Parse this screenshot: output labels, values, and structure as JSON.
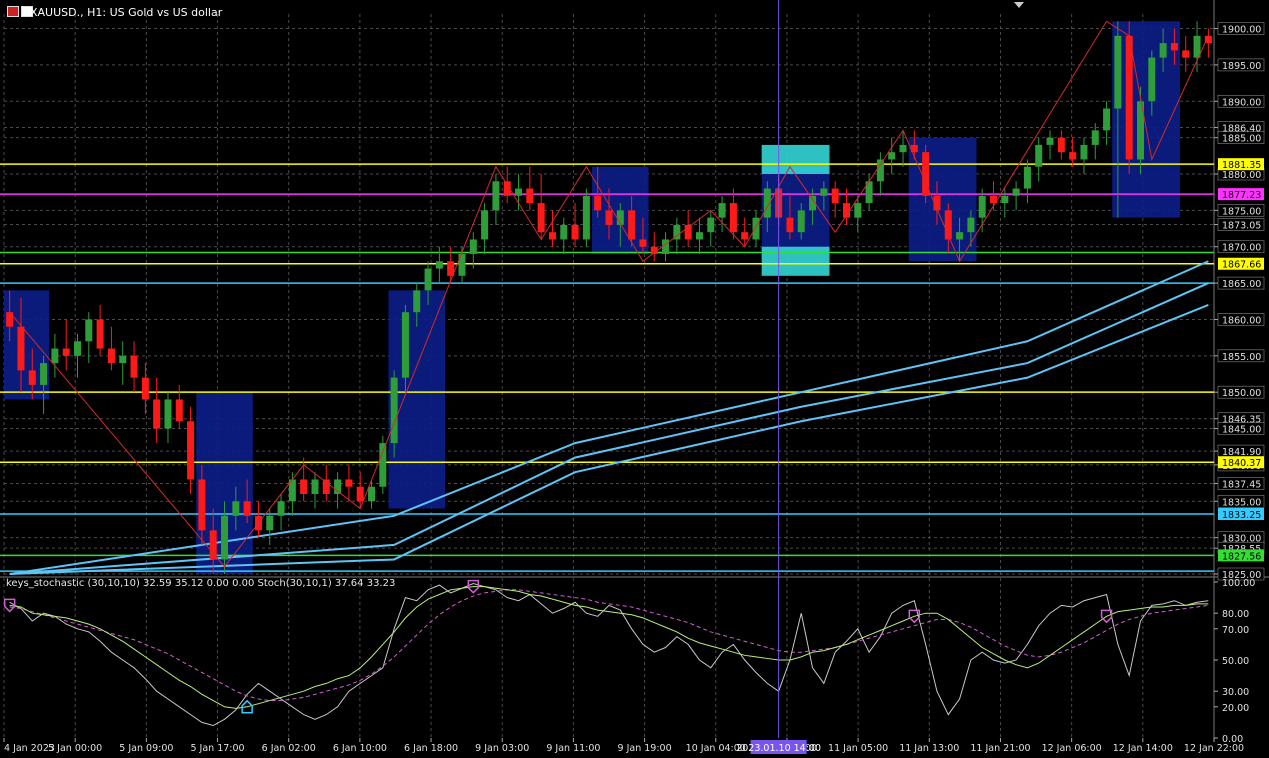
{
  "symbol_title": "XAUUSD., H1:  US Gold vs US dollar",
  "indicator_title": "keys_stochastic (30,10,10) 32.59 35.12 0.00 0.00 Stoch(30,10,1) 37.64 33.23",
  "crosshair_time": "2023.01.10 14:00",
  "icons": [
    "chart-bars-icon",
    "chart-candles-icon"
  ],
  "colors": {
    "bull": "#2e9d3a",
    "bear": "#ff1a1a",
    "zone": "#0b1e8a",
    "zigzag": "#d42a2a",
    "ma": "#5ec4f5",
    "grid": "#4a4a4a",
    "k_line": "#c8c8c8",
    "d_line": "#b7f07a",
    "signal": "#d060d0"
  },
  "chart_data": {
    "type": "candlestick",
    "timeframe": "H1",
    "ylim": [
      1825,
      1902
    ],
    "price_ticks": [
      "1900.00",
      "1895.00",
      "1890.00",
      "1886.40",
      "1885.00",
      "1880.00",
      "1875.00",
      "1873.05",
      "1870.00",
      "1865.00",
      "1860.00",
      "1855.00",
      "1850.00",
      "1846.35",
      "1845.00",
      "1841.90",
      "1840.00",
      "1837.45",
      "1835.00",
      "1830.00",
      "1828.55",
      "1825.00"
    ],
    "time_labels": [
      "4 Jan 2023",
      "5 Jan 00:00",
      "5 Jan 09:00",
      "5 Jan 17:00",
      "6 Jan 02:00",
      "6 Jan 10:00",
      "6 Jan 18:00",
      "9 Jan 03:00",
      "9 Jan 11:00",
      "9 Jan 19:00",
      "10 Jan 04:00",
      "10 Jan 20:00",
      "11 Jan 05:00",
      "11 Jan 13:00",
      "11 Jan 21:00",
      "12 Jan 06:00",
      "12 Jan 14:00",
      "12 Jan 22:00"
    ],
    "horizontal_levels": [
      {
        "price": 1881.35,
        "label": "1881.35",
        "color": "#ffff00"
      },
      {
        "price": 1877.23,
        "label": "1877.23",
        "color": "#ff33ff"
      },
      {
        "price": 1869.2,
        "label": "",
        "color": "#33dd33"
      },
      {
        "price": 1867.66,
        "label": "1867.66",
        "color": "#ffff00"
      },
      {
        "price": 1865.0,
        "label": "",
        "color": "#33ccff"
      },
      {
        "price": 1850.0,
        "label": "",
        "color": "#ffff00"
      },
      {
        "price": 1840.37,
        "label": "1840.37",
        "color": "#ffff00"
      },
      {
        "price": 1833.25,
        "label": "1833.25",
        "color": "#33ccff"
      },
      {
        "price": 1827.56,
        "label": "1827.56",
        "color": "#33dd33"
      },
      {
        "price": 1825.4,
        "label": "",
        "color": "#33ccff"
      }
    ],
    "candles": [
      {
        "o": 1861,
        "h": 1864,
        "l": 1857,
        "c": 1859
      },
      {
        "o": 1859,
        "h": 1863,
        "l": 1850,
        "c": 1853
      },
      {
        "o": 1853,
        "h": 1856,
        "l": 1849,
        "c": 1851
      },
      {
        "o": 1851,
        "h": 1855,
        "l": 1847,
        "c": 1854
      },
      {
        "o": 1854,
        "h": 1858,
        "l": 1852,
        "c": 1856
      },
      {
        "o": 1856,
        "h": 1860,
        "l": 1853,
        "c": 1855
      },
      {
        "o": 1855,
        "h": 1858,
        "l": 1852,
        "c": 1857
      },
      {
        "o": 1857,
        "h": 1861,
        "l": 1854,
        "c": 1860
      },
      {
        "o": 1860,
        "h": 1862,
        "l": 1855,
        "c": 1856
      },
      {
        "o": 1856,
        "h": 1859,
        "l": 1853,
        "c": 1854
      },
      {
        "o": 1854,
        "h": 1857,
        "l": 1851,
        "c": 1855
      },
      {
        "o": 1855,
        "h": 1857,
        "l": 1850,
        "c": 1852
      },
      {
        "o": 1852,
        "h": 1854,
        "l": 1847,
        "c": 1849
      },
      {
        "o": 1849,
        "h": 1852,
        "l": 1843,
        "c": 1845
      },
      {
        "o": 1845,
        "h": 1850,
        "l": 1843,
        "c": 1849
      },
      {
        "o": 1849,
        "h": 1851,
        "l": 1845,
        "c": 1846
      },
      {
        "o": 1846,
        "h": 1848,
        "l": 1836,
        "c": 1838
      },
      {
        "o": 1838,
        "h": 1840,
        "l": 1829,
        "c": 1831
      },
      {
        "o": 1831,
        "h": 1834,
        "l": 1825,
        "c": 1827
      },
      {
        "o": 1827,
        "h": 1835,
        "l": 1825,
        "c": 1833
      },
      {
        "o": 1833,
        "h": 1837,
        "l": 1831,
        "c": 1835
      },
      {
        "o": 1835,
        "h": 1838,
        "l": 1832,
        "c": 1833
      },
      {
        "o": 1833,
        "h": 1835,
        "l": 1830,
        "c": 1831
      },
      {
        "o": 1831,
        "h": 1834,
        "l": 1829,
        "c": 1833
      },
      {
        "o": 1833,
        "h": 1836,
        "l": 1831,
        "c": 1835
      },
      {
        "o": 1835,
        "h": 1839,
        "l": 1833,
        "c": 1838
      },
      {
        "o": 1838,
        "h": 1841,
        "l": 1835,
        "c": 1836
      },
      {
        "o": 1836,
        "h": 1839,
        "l": 1834,
        "c": 1838
      },
      {
        "o": 1838,
        "h": 1840,
        "l": 1835,
        "c": 1836
      },
      {
        "o": 1836,
        "h": 1839,
        "l": 1834,
        "c": 1838
      },
      {
        "o": 1838,
        "h": 1840,
        "l": 1835,
        "c": 1837
      },
      {
        "o": 1837,
        "h": 1839,
        "l": 1834,
        "c": 1835
      },
      {
        "o": 1835,
        "h": 1838,
        "l": 1834,
        "c": 1837
      },
      {
        "o": 1837,
        "h": 1844,
        "l": 1836,
        "c": 1843
      },
      {
        "o": 1843,
        "h": 1853,
        "l": 1841,
        "c": 1852
      },
      {
        "o": 1852,
        "h": 1862,
        "l": 1850,
        "c": 1861
      },
      {
        "o": 1861,
        "h": 1865,
        "l": 1859,
        "c": 1864
      },
      {
        "o": 1864,
        "h": 1868,
        "l": 1862,
        "c": 1867
      },
      {
        "o": 1867,
        "h": 1870,
        "l": 1865,
        "c": 1868
      },
      {
        "o": 1868,
        "h": 1870,
        "l": 1865,
        "c": 1866
      },
      {
        "o": 1866,
        "h": 1870,
        "l": 1865,
        "c": 1869
      },
      {
        "o": 1869,
        "h": 1872,
        "l": 1867,
        "c": 1871
      },
      {
        "o": 1871,
        "h": 1876,
        "l": 1869,
        "c": 1875
      },
      {
        "o": 1875,
        "h": 1880,
        "l": 1873,
        "c": 1879
      },
      {
        "o": 1879,
        "h": 1881,
        "l": 1876,
        "c": 1877
      },
      {
        "o": 1877,
        "h": 1880,
        "l": 1875,
        "c": 1878
      },
      {
        "o": 1878,
        "h": 1881,
        "l": 1875,
        "c": 1876
      },
      {
        "o": 1876,
        "h": 1880,
        "l": 1871,
        "c": 1872
      },
      {
        "o": 1872,
        "h": 1875,
        "l": 1870,
        "c": 1871
      },
      {
        "o": 1871,
        "h": 1874,
        "l": 1869,
        "c": 1873
      },
      {
        "o": 1873,
        "h": 1876,
        "l": 1870,
        "c": 1871
      },
      {
        "o": 1871,
        "h": 1878,
        "l": 1870,
        "c": 1877
      },
      {
        "o": 1877,
        "h": 1881,
        "l": 1874,
        "c": 1875
      },
      {
        "o": 1875,
        "h": 1878,
        "l": 1871,
        "c": 1873
      },
      {
        "o": 1873,
        "h": 1876,
        "l": 1870,
        "c": 1875
      },
      {
        "o": 1875,
        "h": 1877,
        "l": 1870,
        "c": 1871
      },
      {
        "o": 1871,
        "h": 1874,
        "l": 1869,
        "c": 1870
      },
      {
        "o": 1870,
        "h": 1872,
        "l": 1868,
        "c": 1869
      },
      {
        "o": 1869,
        "h": 1872,
        "l": 1868,
        "c": 1871
      },
      {
        "o": 1871,
        "h": 1874,
        "l": 1869,
        "c": 1873
      },
      {
        "o": 1873,
        "h": 1875,
        "l": 1870,
        "c": 1871
      },
      {
        "o": 1871,
        "h": 1874,
        "l": 1869,
        "c": 1872
      },
      {
        "o": 1872,
        "h": 1875,
        "l": 1870,
        "c": 1874
      },
      {
        "o": 1874,
        "h": 1877,
        "l": 1872,
        "c": 1876
      },
      {
        "o": 1876,
        "h": 1878,
        "l": 1871,
        "c": 1872
      },
      {
        "o": 1872,
        "h": 1874,
        "l": 1870,
        "c": 1871
      },
      {
        "o": 1871,
        "h": 1875,
        "l": 1870,
        "c": 1874
      },
      {
        "o": 1874,
        "h": 1879,
        "l": 1872,
        "c": 1878
      },
      {
        "o": 1878,
        "h": 1880,
        "l": 1873,
        "c": 1874
      },
      {
        "o": 1874,
        "h": 1877,
        "l": 1871,
        "c": 1872
      },
      {
        "o": 1872,
        "h": 1876,
        "l": 1871,
        "c": 1875
      },
      {
        "o": 1875,
        "h": 1878,
        "l": 1873,
        "c": 1877
      },
      {
        "o": 1877,
        "h": 1879,
        "l": 1875,
        "c": 1878
      },
      {
        "o": 1878,
        "h": 1879,
        "l": 1874,
        "c": 1876
      },
      {
        "o": 1876,
        "h": 1878,
        "l": 1873,
        "c": 1874
      },
      {
        "o": 1874,
        "h": 1877,
        "l": 1872,
        "c": 1876
      },
      {
        "o": 1876,
        "h": 1880,
        "l": 1875,
        "c": 1879
      },
      {
        "o": 1879,
        "h": 1883,
        "l": 1877,
        "c": 1882
      },
      {
        "o": 1882,
        "h": 1885,
        "l": 1880,
        "c": 1883
      },
      {
        "o": 1883,
        "h": 1886,
        "l": 1881,
        "c": 1884
      },
      {
        "o": 1884,
        "h": 1886,
        "l": 1882,
        "c": 1883
      },
      {
        "o": 1883,
        "h": 1884,
        "l": 1876,
        "c": 1877
      },
      {
        "o": 1877,
        "h": 1879,
        "l": 1873,
        "c": 1875
      },
      {
        "o": 1875,
        "h": 1876,
        "l": 1869,
        "c": 1871
      },
      {
        "o": 1871,
        "h": 1874,
        "l": 1868,
        "c": 1872
      },
      {
        "o": 1872,
        "h": 1875,
        "l": 1870,
        "c": 1874
      },
      {
        "o": 1874,
        "h": 1878,
        "l": 1872,
        "c": 1877
      },
      {
        "o": 1877,
        "h": 1879,
        "l": 1875,
        "c": 1876
      },
      {
        "o": 1876,
        "h": 1878,
        "l": 1874,
        "c": 1877
      },
      {
        "o": 1877,
        "h": 1879,
        "l": 1875,
        "c": 1878
      },
      {
        "o": 1878,
        "h": 1882,
        "l": 1876,
        "c": 1881
      },
      {
        "o": 1881,
        "h": 1885,
        "l": 1879,
        "c": 1884
      },
      {
        "o": 1884,
        "h": 1886,
        "l": 1882,
        "c": 1885
      },
      {
        "o": 1885,
        "h": 1886,
        "l": 1882,
        "c": 1883
      },
      {
        "o": 1883,
        "h": 1885,
        "l": 1881,
        "c": 1882
      },
      {
        "o": 1882,
        "h": 1885,
        "l": 1880,
        "c": 1884
      },
      {
        "o": 1884,
        "h": 1887,
        "l": 1882,
        "c": 1886
      },
      {
        "o": 1886,
        "h": 1890,
        "l": 1884,
        "c": 1889
      },
      {
        "o": 1889,
        "h": 1901,
        "l": 1874,
        "c": 1899
      },
      {
        "o": 1899,
        "h": 1901,
        "l": 1880,
        "c": 1882
      },
      {
        "o": 1882,
        "h": 1892,
        "l": 1880,
        "c": 1890
      },
      {
        "o": 1890,
        "h": 1897,
        "l": 1888,
        "c": 1896
      },
      {
        "o": 1896,
        "h": 1900,
        "l": 1894,
        "c": 1898
      },
      {
        "o": 1898,
        "h": 1900,
        "l": 1895,
        "c": 1897
      },
      {
        "o": 1897,
        "h": 1899,
        "l": 1894,
        "c": 1896
      },
      {
        "o": 1896,
        "h": 1901,
        "l": 1894,
        "c": 1899
      },
      {
        "o": 1899,
        "h": 1900,
        "l": 1896,
        "c": 1898
      }
    ],
    "zones": [
      {
        "from": 0,
        "to": 3,
        "top": 1864,
        "bottom": 1849
      },
      {
        "from": 17,
        "to": 21,
        "top": 1850,
        "bottom": 1825
      },
      {
        "from": 34,
        "to": 38,
        "top": 1864,
        "bottom": 1834
      },
      {
        "from": 52,
        "to": 56,
        "top": 1881,
        "bottom": 1869
      },
      {
        "from": 67,
        "to": 72,
        "top": 1881,
        "bottom": 1869
      },
      {
        "from": 80,
        "to": 85,
        "top": 1885,
        "bottom": 1868
      },
      {
        "from": 98,
        "to": 103,
        "top": 1901,
        "bottom": 1874
      }
    ],
    "highlight_zones": [
      {
        "from": 67,
        "to": 72,
        "top": 1884,
        "bottom": 1880
      },
      {
        "from": 67,
        "to": 72,
        "top": 1870,
        "bottom": 1866
      }
    ],
    "zigzag": [
      [
        0,
        1861
      ],
      [
        19,
        1826
      ],
      [
        26,
        1840
      ],
      [
        31,
        1834
      ],
      [
        43,
        1881
      ],
      [
        47,
        1871
      ],
      [
        51,
        1881
      ],
      [
        56,
        1868
      ],
      [
        62,
        1875
      ],
      [
        65,
        1870
      ],
      [
        69,
        1881
      ],
      [
        73,
        1872
      ],
      [
        79,
        1886
      ],
      [
        84,
        1868
      ],
      [
        97,
        1901
      ],
      [
        99,
        1899
      ],
      [
        101,
        1882
      ],
      [
        106,
        1899
      ]
    ],
    "moving_averages": [
      {
        "name": "",
        "points": [
          [
            0,
            1825
          ],
          [
            34,
            1833
          ],
          [
            50,
            1843
          ],
          [
            70,
            1850
          ],
          [
            90,
            1857
          ],
          [
            106,
            1868
          ]
        ]
      },
      {
        "name": "",
        "points": [
          [
            0,
            1825
          ],
          [
            34,
            1829
          ],
          [
            50,
            1841
          ],
          [
            70,
            1848
          ],
          [
            90,
            1854
          ],
          [
            106,
            1865
          ]
        ]
      },
      {
        "name": "",
        "points": [
          [
            0,
            1825
          ],
          [
            34,
            1827
          ],
          [
            50,
            1839
          ],
          [
            70,
            1846
          ],
          [
            90,
            1852
          ],
          [
            106,
            1862
          ]
        ]
      }
    ],
    "stoch_ticks": [
      "100.00",
      "80.00",
      "70.00",
      "50.00",
      "30.00",
      "20.00",
      "0.00"
    ],
    "stoch_k": [
      87,
      83,
      75,
      80,
      78,
      73,
      70,
      68,
      62,
      55,
      50,
      45,
      38,
      30,
      25,
      20,
      15,
      10,
      8,
      12,
      18,
      28,
      35,
      30,
      25,
      20,
      15,
      12,
      15,
      20,
      30,
      35,
      40,
      45,
      70,
      90,
      88,
      95,
      98,
      93,
      96,
      99,
      97,
      95,
      90,
      88,
      92,
      86,
      80,
      83,
      87,
      80,
      78,
      85,
      82,
      70,
      60,
      55,
      58,
      65,
      60,
      50,
      45,
      55,
      60,
      50,
      42,
      35,
      30,
      50,
      80,
      45,
      35,
      55,
      62,
      70,
      55,
      65,
      80,
      85,
      88,
      60,
      30,
      15,
      25,
      50,
      55,
      50,
      48,
      50,
      60,
      72,
      80,
      85,
      84,
      88,
      90,
      92,
      60,
      40,
      75,
      85,
      86,
      88,
      85,
      87,
      88
    ],
    "stoch_d": [
      85,
      84,
      80,
      79,
      78,
      77,
      75,
      73,
      70,
      66,
      62,
      57,
      52,
      47,
      42,
      37,
      33,
      28,
      24,
      20,
      19,
      20,
      22,
      24,
      26,
      28,
      30,
      33,
      35,
      38,
      40,
      45,
      52,
      60,
      68,
      77,
      84,
      89,
      92,
      95,
      96,
      97,
      97,
      96,
      95,
      94,
      92,
      91,
      89,
      87,
      85,
      84,
      82,
      81,
      80,
      79,
      77,
      74,
      71,
      68,
      64,
      61,
      59,
      57,
      55,
      53,
      52,
      51,
      50,
      50,
      52,
      55,
      56,
      58,
      60,
      63,
      66,
      69,
      72,
      75,
      78,
      80,
      80,
      76,
      70,
      64,
      58,
      54,
      50,
      47,
      45,
      48,
      53,
      58,
      63,
      68,
      73,
      78,
      81,
      82,
      83,
      84,
      84,
      85,
      85,
      86,
      86
    ],
    "stoch_signal": [
      84,
      83,
      81,
      79,
      77,
      75,
      73,
      71,
      69,
      67,
      65,
      63,
      60,
      57,
      54,
      50,
      46,
      42,
      38,
      34,
      30,
      27,
      25,
      24,
      24,
      25,
      26,
      28,
      30,
      32,
      34,
      37,
      41,
      46,
      52,
      59,
      66,
      73,
      79,
      84,
      88,
      91,
      93,
      94,
      95,
      95,
      94,
      93,
      92,
      91,
      90,
      89,
      87,
      86,
      85,
      84,
      82,
      80,
      78,
      76,
      74,
      71,
      68,
      66,
      64,
      62,
      60,
      58,
      56,
      55,
      55,
      56,
      57,
      58,
      60,
      62,
      64,
      66,
      68,
      70,
      72,
      74,
      76,
      76,
      74,
      71,
      67,
      63,
      59,
      56,
      53,
      52,
      53,
      55,
      58,
      61,
      65,
      69,
      73,
      76,
      78,
      80,
      81,
      82,
      83,
      84,
      85
    ],
    "signal_markers": [
      {
        "index": 0,
        "kind": "down",
        "color": "#d060d0"
      },
      {
        "index": 21,
        "kind": "up",
        "color": "#33ccff"
      },
      {
        "index": 41,
        "kind": "down",
        "color": "#d060d0"
      },
      {
        "index": 80,
        "kind": "down",
        "color": "#d060d0"
      },
      {
        "index": 97,
        "kind": "down",
        "color": "#d060d0"
      }
    ]
  }
}
